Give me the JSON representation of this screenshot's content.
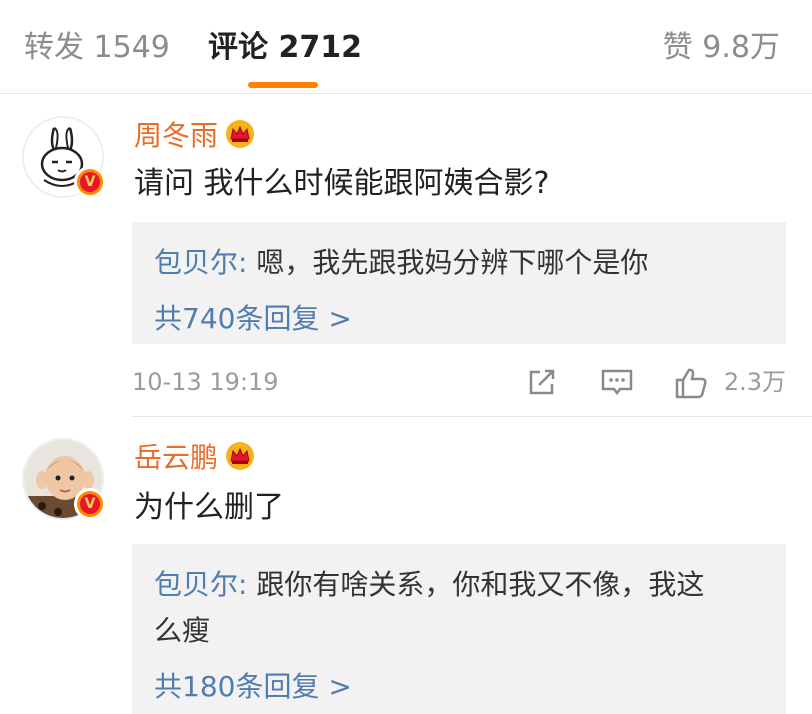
{
  "tabs": {
    "repost": "转发 1549",
    "comments": "评论 2712",
    "likes": "赞 9.8万"
  },
  "accent_color": "#ff8200",
  "comments": [
    {
      "username": "周冬雨",
      "badge_icon": "crown-icon",
      "verified_icon": "v-badge-icon",
      "text": "请问 我什么时候能跟阿姨合影?",
      "reply": {
        "author": "包贝尔:",
        "text": " 嗯，我先跟我妈分辨下哪个是你",
        "more": "共740条回复 >"
      },
      "time": "10-13 19:19",
      "like_count": "2.3万"
    },
    {
      "username": "岳云鹏",
      "badge_icon": "crown-icon",
      "verified_icon": "v-badge-icon",
      "text": "为什么删了",
      "reply": {
        "author": "包贝尔:",
        "text_line1": " 跟你有啥关系，你和我又不像，我这",
        "text_line2": "么瘦",
        "more": "共180条回复 >"
      }
    }
  ]
}
